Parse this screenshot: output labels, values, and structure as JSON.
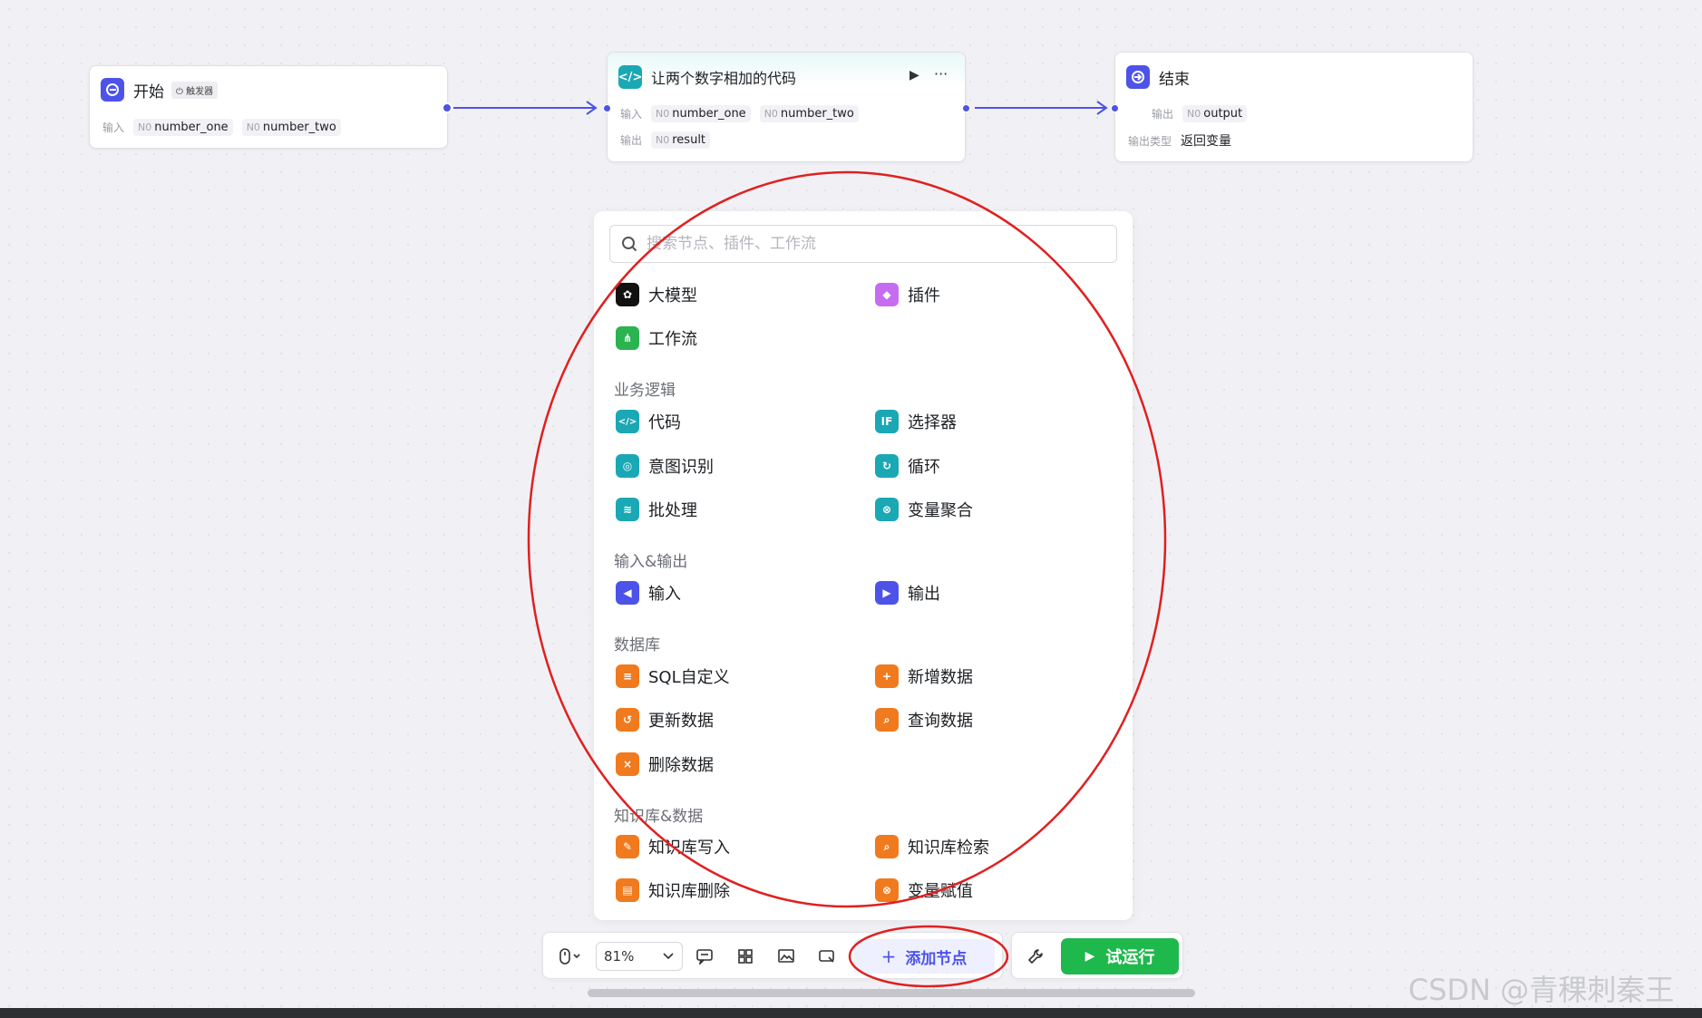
{
  "colors": {
    "accent": "#4d53e8",
    "code": "#1aa8b5",
    "plugin": "#c66cf0",
    "workflow": "#2bb34f",
    "database": "#f07a1e",
    "run": "#1fb84d",
    "annotation": "#e02020"
  },
  "nodes": {
    "start": {
      "title": "开始",
      "tag": "触发器",
      "tag_icon": "trigger-icon",
      "input_label": "输入",
      "vars": [
        {
          "type": "N0",
          "name": "number_one"
        },
        {
          "type": "N0",
          "name": "number_two"
        }
      ]
    },
    "code": {
      "title": "让两个数字相加的代码",
      "input_label": "输入",
      "output_label": "输出",
      "inputs": [
        {
          "type": "N0",
          "name": "number_one"
        },
        {
          "type": "N0",
          "name": "number_two"
        }
      ],
      "outputs": [
        {
          "type": "N0",
          "name": "result"
        }
      ],
      "run_icon": "▶",
      "more_icon": "···"
    },
    "end": {
      "title": "结束",
      "output_label": "输出",
      "output_var": {
        "type": "N0",
        "name": "output"
      },
      "output_type_label": "输出类型",
      "output_type_value": "返回变量"
    }
  },
  "panel": {
    "search_placeholder": "搜索节点、插件、工作流",
    "top_items": [
      {
        "label": "大模型",
        "icon": "llm-icon"
      },
      {
        "label": "插件",
        "icon": "plugin-icon"
      },
      {
        "label": "工作流",
        "icon": "workflow-icon"
      }
    ],
    "sections": [
      {
        "title": "业务逻辑",
        "items": [
          {
            "label": "代码",
            "icon": "code-icon"
          },
          {
            "label": "选择器",
            "icon": "if-icon"
          },
          {
            "label": "意图识别",
            "icon": "intent-icon"
          },
          {
            "label": "循环",
            "icon": "loop-icon"
          },
          {
            "label": "批处理",
            "icon": "batch-icon"
          },
          {
            "label": "变量聚合",
            "icon": "aggregate-icon"
          }
        ]
      },
      {
        "title": "输入&输出",
        "items": [
          {
            "label": "输入",
            "icon": "input-icon"
          },
          {
            "label": "输出",
            "icon": "output-icon"
          }
        ]
      },
      {
        "title": "数据库",
        "items": [
          {
            "label": "SQL自定义",
            "icon": "sql-icon"
          },
          {
            "label": "新增数据",
            "icon": "db-add-icon"
          },
          {
            "label": "更新数据",
            "icon": "db-update-icon"
          },
          {
            "label": "查询数据",
            "icon": "db-query-icon"
          },
          {
            "label": "删除数据",
            "icon": "db-delete-icon"
          }
        ]
      },
      {
        "title": "知识库&数据",
        "items": [
          {
            "label": "知识库写入",
            "icon": "kb-write-icon"
          },
          {
            "label": "知识库检索",
            "icon": "kb-search-icon"
          },
          {
            "label": "知识库删除",
            "icon": "kb-delete-icon"
          },
          {
            "label": "变量赋值",
            "icon": "assign-icon"
          }
        ]
      }
    ]
  },
  "toolbar": {
    "zoom": "81%",
    "add_node": "添加节点",
    "add_icon": "+",
    "run": "试运行"
  },
  "watermark": "CSDN @青稞刺秦王"
}
